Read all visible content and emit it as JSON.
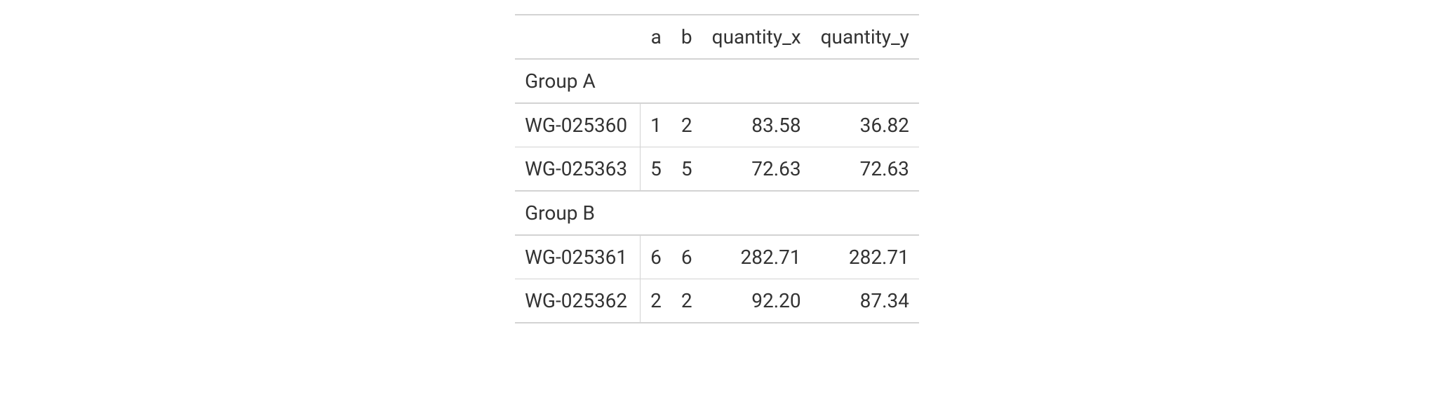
{
  "chart_data": {
    "type": "table",
    "columns": [
      "a",
      "b",
      "quantity_x",
      "quantity_y"
    ],
    "groups": [
      {
        "label": "Group A",
        "rows": [
          {
            "stub": "WG-025360",
            "a": "1",
            "b": "2",
            "quantity_x": "83.58",
            "quantity_y": "36.82"
          },
          {
            "stub": "WG-025363",
            "a": "5",
            "b": "5",
            "quantity_x": "72.63",
            "quantity_y": "72.63"
          }
        ]
      },
      {
        "label": "Group B",
        "rows": [
          {
            "stub": "WG-025361",
            "a": "6",
            "b": "6",
            "quantity_x": "282.71",
            "quantity_y": "282.71"
          },
          {
            "stub": "WG-025362",
            "a": "2",
            "b": "2",
            "quantity_x": "92.20",
            "quantity_y": "87.34"
          }
        ]
      }
    ]
  }
}
